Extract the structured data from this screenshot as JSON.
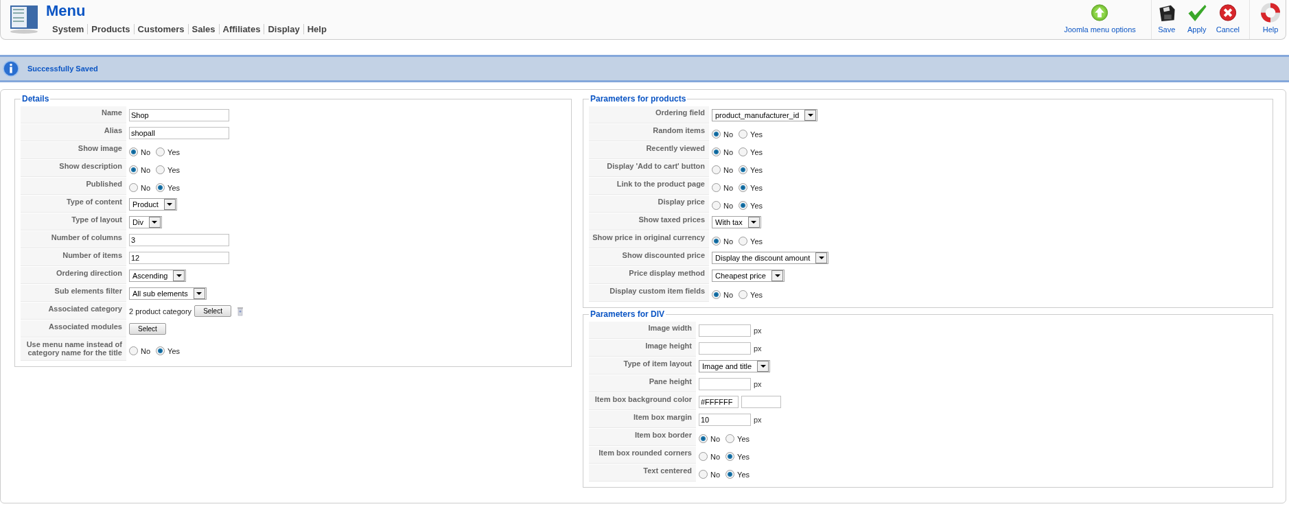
{
  "header": {
    "title": "Menu",
    "menu": [
      "System",
      "Products",
      "Customers",
      "Sales",
      "Affiliates",
      "Display",
      "Help"
    ]
  },
  "toolbar": [
    {
      "kind": "options",
      "label": "Joomla menu options"
    },
    {
      "kind": "save",
      "label": "Save"
    },
    {
      "kind": "apply",
      "label": "Apply"
    },
    {
      "kind": "cancel",
      "label": "Cancel"
    },
    {
      "kind": "help",
      "label": "Help"
    }
  ],
  "message": "Successfully Saved",
  "sections": [
    {
      "title": "Details",
      "rows": [
        {
          "label": "Name",
          "kind": "text",
          "value": "Shop"
        },
        {
          "label": "Alias",
          "kind": "text",
          "value": "shopall"
        },
        {
          "label": "Show image",
          "kind": "radio",
          "options": [
            {
              "label": "No",
              "selected": true
            },
            {
              "label": "Yes",
              "selected": false
            }
          ]
        },
        {
          "label": "Show description",
          "kind": "radio",
          "options": [
            {
              "label": "No",
              "selected": true
            },
            {
              "label": "Yes",
              "selected": false
            }
          ]
        },
        {
          "label": "Published",
          "kind": "radio",
          "options": [
            {
              "label": "No",
              "selected": false
            },
            {
              "label": "Yes",
              "selected": true
            }
          ]
        },
        {
          "label": "Type of content",
          "kind": "select",
          "value": "Product"
        },
        {
          "label": "Type of layout",
          "kind": "select",
          "value": "Div"
        },
        {
          "label": "Number of columns",
          "kind": "text",
          "value": "3"
        },
        {
          "label": "Number of items",
          "kind": "text",
          "value": "12"
        },
        {
          "label": "Ordering direction",
          "kind": "select",
          "value": "Ascending"
        },
        {
          "label": "Sub elements filter",
          "kind": "select",
          "value": "All sub elements"
        },
        {
          "label": "Associated category",
          "kind": "category",
          "value": "2 product category",
          "button": "Select"
        },
        {
          "label": "Associated modules",
          "kind": "button",
          "button": "Select"
        },
        {
          "label": "Use menu name instead of category name for the title",
          "kind": "radio",
          "options": [
            {
              "label": "No",
              "selected": false
            },
            {
              "label": "Yes",
              "selected": true
            }
          ]
        }
      ]
    },
    {
      "title": "Parameters for products",
      "rows": [
        {
          "label": "Ordering field",
          "kind": "select",
          "value": "product_manufacturer_id"
        },
        {
          "label": "Random items",
          "kind": "radio",
          "options": [
            {
              "label": "No",
              "selected": true
            },
            {
              "label": "Yes",
              "selected": false
            }
          ]
        },
        {
          "label": "Recently viewed",
          "kind": "radio",
          "options": [
            {
              "label": "No",
              "selected": true
            },
            {
              "label": "Yes",
              "selected": false
            }
          ]
        },
        {
          "label": "Display 'Add to cart' button",
          "kind": "radio",
          "options": [
            {
              "label": "No",
              "selected": false
            },
            {
              "label": "Yes",
              "selected": true
            }
          ]
        },
        {
          "label": "Link to the product page",
          "kind": "radio",
          "options": [
            {
              "label": "No",
              "selected": false
            },
            {
              "label": "Yes",
              "selected": true
            }
          ]
        },
        {
          "label": "Display price",
          "kind": "radio",
          "options": [
            {
              "label": "No",
              "selected": false
            },
            {
              "label": "Yes",
              "selected": true
            }
          ]
        },
        {
          "label": "Show taxed prices",
          "kind": "select",
          "value": "With tax"
        },
        {
          "label": "Show price in original currency",
          "kind": "radio",
          "options": [
            {
              "label": "No",
              "selected": true
            },
            {
              "label": "Yes",
              "selected": false
            }
          ]
        },
        {
          "label": "Show discounted price",
          "kind": "select",
          "value": "Display the discount amount"
        },
        {
          "label": "Price display method",
          "kind": "select",
          "value": "Cheapest price"
        },
        {
          "label": "Display custom item fields",
          "kind": "radio",
          "options": [
            {
              "label": "No",
              "selected": true
            },
            {
              "label": "Yes",
              "selected": false
            }
          ]
        }
      ]
    },
    {
      "title": "Parameters for DIV",
      "rows": [
        {
          "label": "Image width",
          "kind": "text",
          "unit": "px"
        },
        {
          "label": "Image height",
          "kind": "text",
          "unit": "px"
        },
        {
          "label": "Type of item layout",
          "kind": "select",
          "value": "Image and title"
        },
        {
          "label": "Pane height",
          "kind": "text",
          "unit": "px"
        },
        {
          "label": "Item box background color",
          "kind": "color",
          "value": "#FFFFFF"
        },
        {
          "label": "Item box margin",
          "kind": "text",
          "value": "10",
          "unit": "px"
        },
        {
          "label": "Item box border",
          "kind": "radio",
          "options": [
            {
              "label": "No",
              "selected": true
            },
            {
              "label": "Yes",
              "selected": false
            }
          ]
        },
        {
          "label": "Item box rounded corners",
          "kind": "radio",
          "options": [
            {
              "label": "No",
              "selected": false
            },
            {
              "label": "Yes",
              "selected": true
            }
          ]
        },
        {
          "label": "Text centered",
          "kind": "radio",
          "options": [
            {
              "label": "No",
              "selected": false
            },
            {
              "label": "Yes",
              "selected": true
            }
          ]
        }
      ]
    }
  ]
}
